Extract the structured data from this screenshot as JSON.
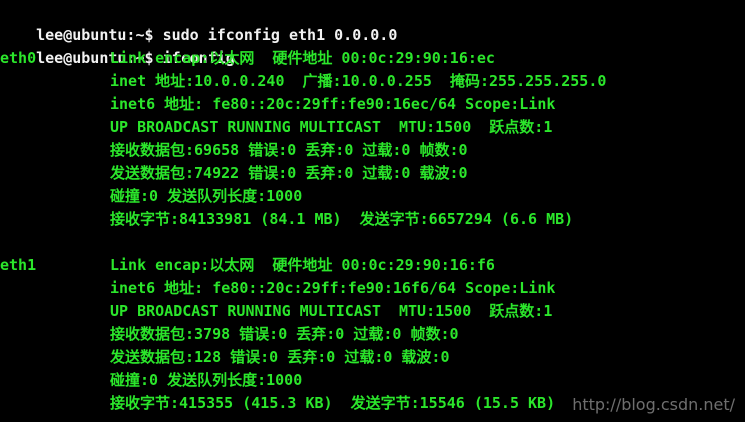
{
  "terminal": {
    "commands": [
      {
        "prompt": "lee@ubuntu:~$ ",
        "command": "sudo ifconfig eth1 0.0.0.0"
      },
      {
        "prompt": "lee@ubuntu:~$ ",
        "command": "ifconfig"
      }
    ],
    "interfaces": [
      {
        "name": "eth0",
        "lines": [
          "Link encap:以太网  硬件地址 00:0c:29:90:16:ec",
          "inet 地址:10.0.0.240  广播:10.0.0.255  掩码:255.255.255.0",
          "inet6 地址: fe80::20c:29ff:fe90:16ec/64 Scope:Link",
          "UP BROADCAST RUNNING MULTICAST  MTU:1500  跃点数:1",
          "接收数据包:69658 错误:0 丢弃:0 过载:0 帧数:0",
          "发送数据包:74922 错误:0 丢弃:0 过载:0 载波:0",
          "碰撞:0 发送队列长度:1000",
          "接收字节:84133981 (84.1 MB)  发送字节:6657294 (6.6 MB)"
        ]
      },
      {
        "name": "eth1",
        "lines": [
          "Link encap:以太网  硬件地址 00:0c:29:90:16:f6",
          "inet6 地址: fe80::20c:29ff:fe90:16f6/64 Scope:Link",
          "UP BROADCAST RUNNING MULTICAST  MTU:1500  跃点数:1",
          "接收数据包:3798 错误:0 丢弃:0 过载:0 帧数:0",
          "发送数据包:128 错误:0 丢弃:0 过载:0 载波:0",
          "碰撞:0 发送队列长度:1000",
          "接收字节:415355 (415.3 KB)  发送字节:15546 (15.5 KB)"
        ]
      }
    ],
    "watermark": "http://blog.csdn.net/"
  },
  "colors": {
    "background": "#000000",
    "output_text": "#2be62b",
    "prompt_text": "#f2f2f2"
  }
}
